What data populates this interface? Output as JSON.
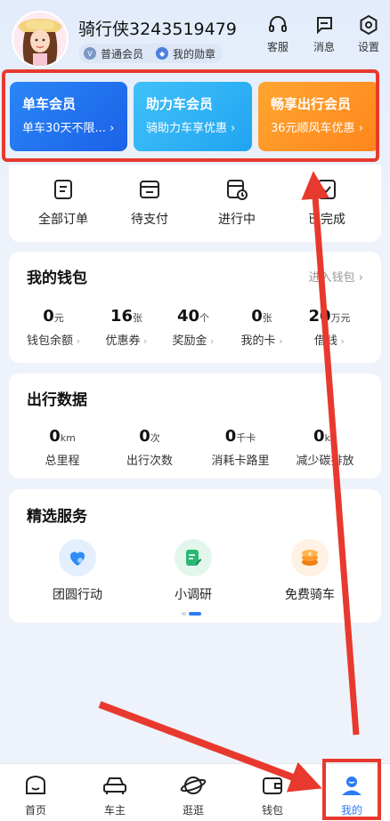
{
  "user": {
    "name": "骑行侠3243519479",
    "level_badge": "普通会员",
    "medal_badge": "我的勋章"
  },
  "header_actions": [
    {
      "label": "客服",
      "icon": "headset-icon"
    },
    {
      "label": "消息",
      "icon": "message-icon"
    },
    {
      "label": "设置",
      "icon": "settings-icon"
    }
  ],
  "memberships": [
    {
      "title": "单车会员",
      "subtitle": "单车30天不限...",
      "color": "#1f6ef2"
    },
    {
      "title": "助力车会员",
      "subtitle": "骑助力车享优惠",
      "color": "#2fb0f5"
    },
    {
      "title": "畅享出行会员",
      "subtitle": "36元顺风车优惠",
      "color": "#ff8f1f"
    }
  ],
  "orders": [
    {
      "label": "全部订单",
      "icon": "orders-icon"
    },
    {
      "label": "待支付",
      "icon": "pending-payment-icon"
    },
    {
      "label": "进行中",
      "icon": "in-progress-icon"
    },
    {
      "label": "已完成",
      "icon": "completed-icon"
    }
  ],
  "wallet": {
    "title": "我的钱包",
    "link": "进入钱包",
    "items": [
      {
        "value": "0",
        "unit": "元",
        "label": "钱包余额"
      },
      {
        "value": "16",
        "unit": "张",
        "label": "优惠券"
      },
      {
        "value": "40",
        "unit": "个",
        "label": "奖励金"
      },
      {
        "value": "0",
        "unit": "张",
        "label": "我的卡"
      },
      {
        "value": "20",
        "unit": "万元",
        "label": "借钱"
      }
    ]
  },
  "travel": {
    "title": "出行数据",
    "items": [
      {
        "value": "0",
        "unit": "km",
        "label": "总里程"
      },
      {
        "value": "0",
        "unit": "次",
        "label": "出行次数"
      },
      {
        "value": "0",
        "unit": "千卡",
        "label": "消耗卡路里"
      },
      {
        "value": "0",
        "unit": "kg",
        "label": "减少碳排放"
      }
    ]
  },
  "services": {
    "title": "精选服务",
    "items": [
      {
        "label": "团圆行动",
        "icon": "heart-icon",
        "color": "#2f8cf5"
      },
      {
        "label": "小调研",
        "icon": "survey-icon",
        "color": "#2bb673"
      },
      {
        "label": "免费骑车",
        "icon": "coin-icon",
        "color": "#ff8f1f"
      }
    ]
  },
  "tabs": [
    {
      "label": "首页",
      "icon": "home-icon"
    },
    {
      "label": "车主",
      "icon": "car-icon"
    },
    {
      "label": "逛逛",
      "icon": "planet-icon"
    },
    {
      "label": "钱包",
      "icon": "wallet-icon"
    },
    {
      "label": "我的",
      "icon": "profile-icon",
      "active": true
    }
  ],
  "colors": {
    "accent": "#2a7cf6",
    "annotation": "#e8392e"
  }
}
